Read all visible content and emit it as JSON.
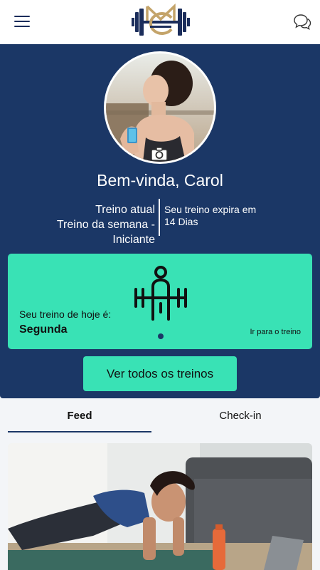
{
  "header": {
    "menu_icon": "menu-icon",
    "logo_icon": "dumbbell-logo",
    "chat_icon": "chat-bubbles-icon"
  },
  "profile": {
    "greeting": "Bem-vinda, Carol",
    "plan_line1": "Treino atual",
    "plan_line2": "Treino da semana -",
    "plan_line3": "Iniciante",
    "expire_line1": "Seu treino expira em",
    "expire_line2": "14 Dias",
    "camera_icon": "camera-icon"
  },
  "today_card": {
    "label": "Seu treino de hoje é:",
    "day": "Segunda",
    "link": "Ir para o treino",
    "icon": "weightlifter-icon"
  },
  "all_workouts_button": "Ver todos os treinos",
  "tabs": {
    "feed": "Feed",
    "checkin": "Check-in"
  },
  "colors": {
    "navy": "#1b3766",
    "mint": "#39e2b5",
    "gold": "#c4a46a"
  }
}
